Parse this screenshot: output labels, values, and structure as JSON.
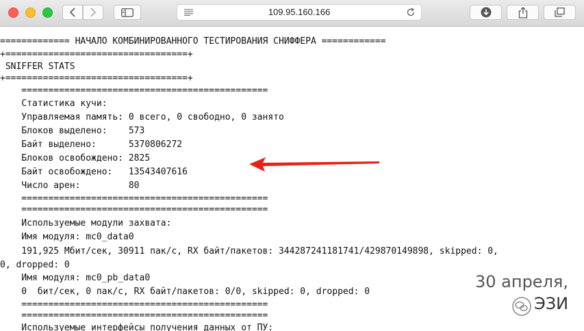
{
  "browser": {
    "url": "109.95.160.166",
    "icons": {
      "back": "chevron-left-icon",
      "forward": "chevron-right-icon",
      "sidebar": "sidebar-icon",
      "reader": "hamburger-icon",
      "reload": "reload-icon",
      "download": "download-icon",
      "share": "share-icon",
      "tabs": "tabs-icon"
    }
  },
  "terminal": {
    "lines": [
      "============= НАЧАЛО КОМБИНИРОВАННОГО ТЕСТИРОВАНИЯ СНИФФЕРА ============",
      "+==================================+",
      " SNIFFER STATS",
      "+==================================+",
      "    ==============================================",
      "    Статистика кучи:",
      "    Управляемая память: 0 всего, 0 свободно, 0 занято",
      "    Блоков выделено:    573",
      "    Байт выделено:      5370806272",
      "    Блоков освобождено: 2825",
      "    Байт освобождено:   13543407616",
      "    Число арен:         80",
      "    ==============================================",
      "    ==============================================",
      "    Используемые модули захвата:",
      "    Имя модуля: mc0_data0",
      "    191,925 Мбит/сек, 30911 пак/с, RX байт/пакетов: 344287241181741/429870149898, skipped: 0,",
      "0, dropped: 0",
      "    Имя модуля: mc0_pb_data0",
      "    0  бит/сек, 0 пак/с, RX байт/пакетов: 0/0, skipped: 0, dropped: 0",
      "    ==============================================",
      "    ==============================================",
      "    Используемые интерфейсы получения данных от ПУ:"
    ]
  },
  "annotation": {
    "arrow_color": "#e8221a"
  },
  "watermark": {
    "date": "30 апреля,",
    "text": "ЭЗИ"
  }
}
